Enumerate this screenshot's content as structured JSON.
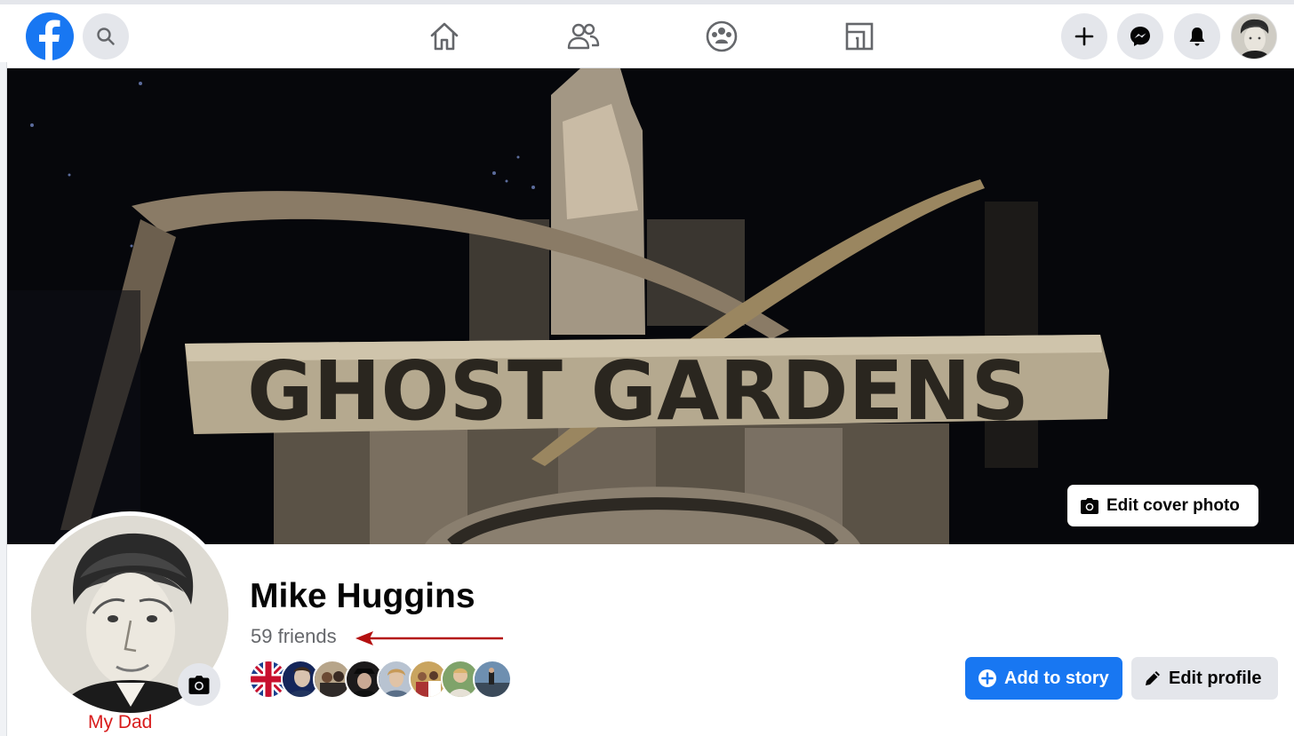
{
  "nav": {
    "home_icon": "home-icon",
    "friends_icon": "friends-icon",
    "groups_icon": "groups-icon",
    "gaming_icon": "gaming-icon",
    "create_icon": "plus-icon",
    "messenger_icon": "messenger-icon",
    "notifications_icon": "bell-icon"
  },
  "cover": {
    "sign_text": "GHOST GARDENS",
    "edit_label": "Edit cover photo"
  },
  "profile": {
    "name": "Mike Huggins",
    "friends_count": "59 friends",
    "caption": "My Dad"
  },
  "actions": {
    "add_story_label": "Add to story",
    "edit_profile_label": "Edit profile"
  },
  "colors": {
    "brand_blue": "#1877f2",
    "annotation_red": "#c00000",
    "button_gray": "#e4e6eb"
  }
}
